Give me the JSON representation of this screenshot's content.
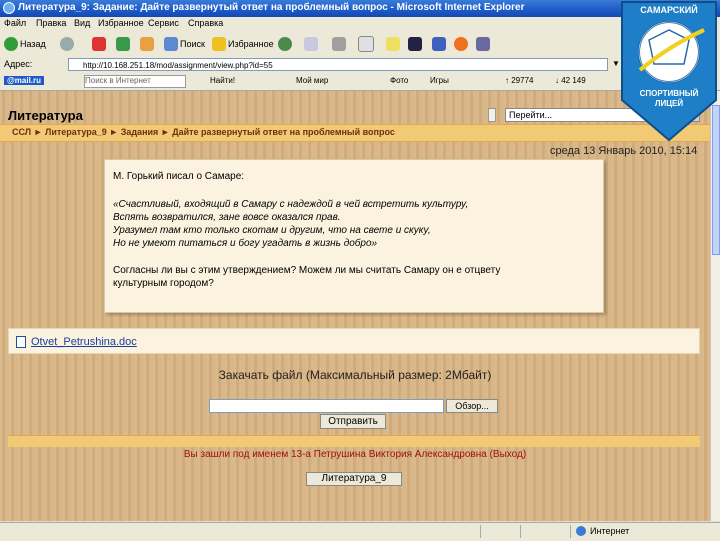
{
  "window": {
    "title": "Литература_9: Задание: Дайте развернутый ответ на проблемный вопрос - Microsoft Internet Explorer"
  },
  "menu": [
    "Файл",
    "Правка",
    "Вид",
    "Избранное",
    "Сервис",
    "Справка"
  ],
  "toolbar": {
    "back": "Назад",
    "search": "Поиск",
    "favorites": "Избранное"
  },
  "address": {
    "label": "Адрес:",
    "url": "http://10.168.251.18/mod/assignment/view.php?id=55"
  },
  "mailbar": {
    "logo": "@mail.ru",
    "search_placeholder": "Поиск в Интернет",
    "find": "Найти!",
    "mymail": "Мой мир",
    "photo": "Фото",
    "games": "Игры",
    "stat1": "↑ 29774",
    "stat2": "↓ 42 149"
  },
  "page": {
    "title": "Литература",
    "jump": "Перейти...",
    "breadcrumb": "ССЛ ► Литература_9 ► Задания ► Дайте развернутый ответ на проблемный вопрос",
    "date": "среда 13 Январь 2010, 15:14",
    "assignment": {
      "intro": "М. Горький писал о Самаре:",
      "quote": [
        "«Счастливый, входящий в Самару с надеждой в чей встретить культуру,",
        "Вспять возвратился, зане вовсе оказался прав.",
        "Уразумел там кто только скотам и другим, что на свете и скуку,",
        "Но не умеют питаться и богу угадать в жизнь добро»"
      ],
      "question": [
        "Согласны ли вы с этим утверждением? Можем ли мы считать Самару он е отцвету",
        "культурным городом?"
      ]
    },
    "file": "Otvet_Petrushina.doc",
    "upload_label": "Закачать файл (Максимальный размер: 2Мбайт)",
    "browse": "Обзор...",
    "send": "Отправить",
    "login_info": "Вы зашли под именем 13-а Петрушина Виктория Александровна (Выход)",
    "course_button": "Литература_9"
  },
  "status": {
    "zone": "Интернет"
  },
  "logo": {
    "text_top": "САМАРСКИЙ",
    "text_bottom": "СПОРТИВНЫЙ ЛИЦЕЙ"
  },
  "colors": {
    "titlebar": "#1c5ac8",
    "page_bg": "#d9b584",
    "navbar": "#f2c975",
    "link": "#1a3f9e",
    "login": "#a01010"
  }
}
